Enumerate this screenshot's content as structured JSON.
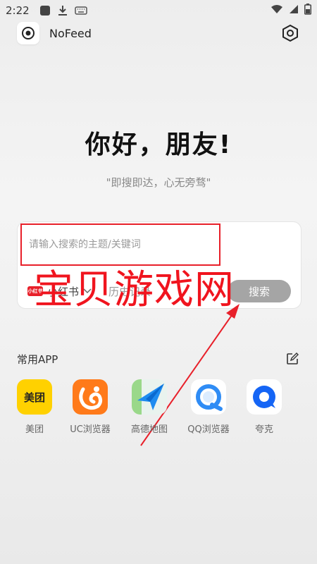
{
  "status_bar": {
    "time": "2:22"
  },
  "app_bar": {
    "title": "NoFeed"
  },
  "greeting": "你好，朋友!",
  "slogan": "\"即搜即达，心无旁骛\"",
  "search": {
    "placeholder": "请输入搜索的主题/关键词",
    "engine_logo_text": "小红书",
    "engine_name": "小红书",
    "history_label": "历史记录",
    "button_label": "搜索"
  },
  "watermark": "宝贝游戏网",
  "apps_section": {
    "title": "常用APP",
    "apps": [
      {
        "label": "美团",
        "icon": "meituan-icon",
        "icon_text": "美团"
      },
      {
        "label": "UC浏览器",
        "icon": "uc-browser-icon"
      },
      {
        "label": "高德地图",
        "icon": "amap-icon"
      },
      {
        "label": "QQ浏览器",
        "icon": "qq-browser-icon"
      },
      {
        "label": "夸克",
        "icon": "quark-icon"
      }
    ]
  },
  "colors": {
    "accent_red": "#e8202a",
    "search_button": "#a5a5a5",
    "meituan_yellow": "#ffd100",
    "uc_orange": "#ff7a1a"
  }
}
